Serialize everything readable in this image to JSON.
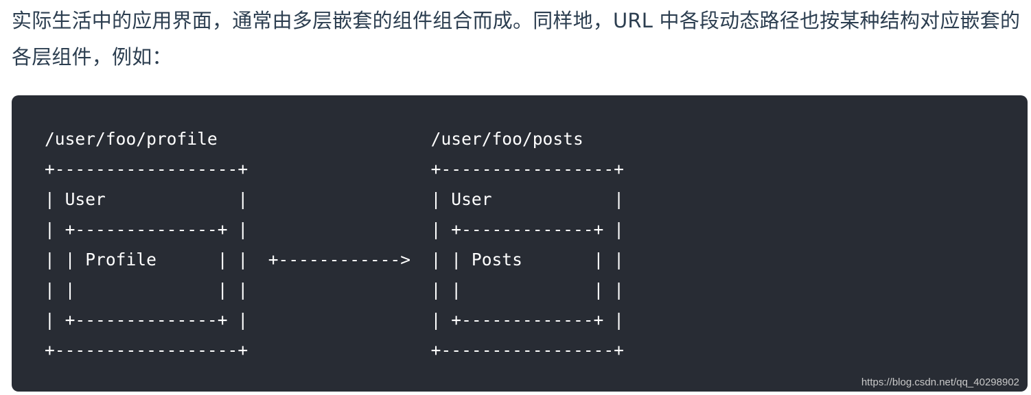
{
  "intro": {
    "text": "实际生活中的应用界面，通常由多层嵌套的组件组合而成。同样地，URL 中各段动态路径也按某种结构对应嵌套的各层组件，例如："
  },
  "code_block": {
    "language": "text",
    "lines": [
      "/user/foo/profile                     /user/foo/posts",
      "+------------------+                  +-----------------+",
      "| User             |                  | User            |",
      "| +--------------+ |                  | +-------------+ |",
      "| | Profile      | |  +------------>  | | Posts       | |",
      "| |              | |                  | |             | |",
      "| +--------------+ |                  | +-------------+ |",
      "+------------------+                  +-----------------+"
    ]
  },
  "watermark": {
    "text": "https://blog.csdn.net/qq_40298902"
  }
}
